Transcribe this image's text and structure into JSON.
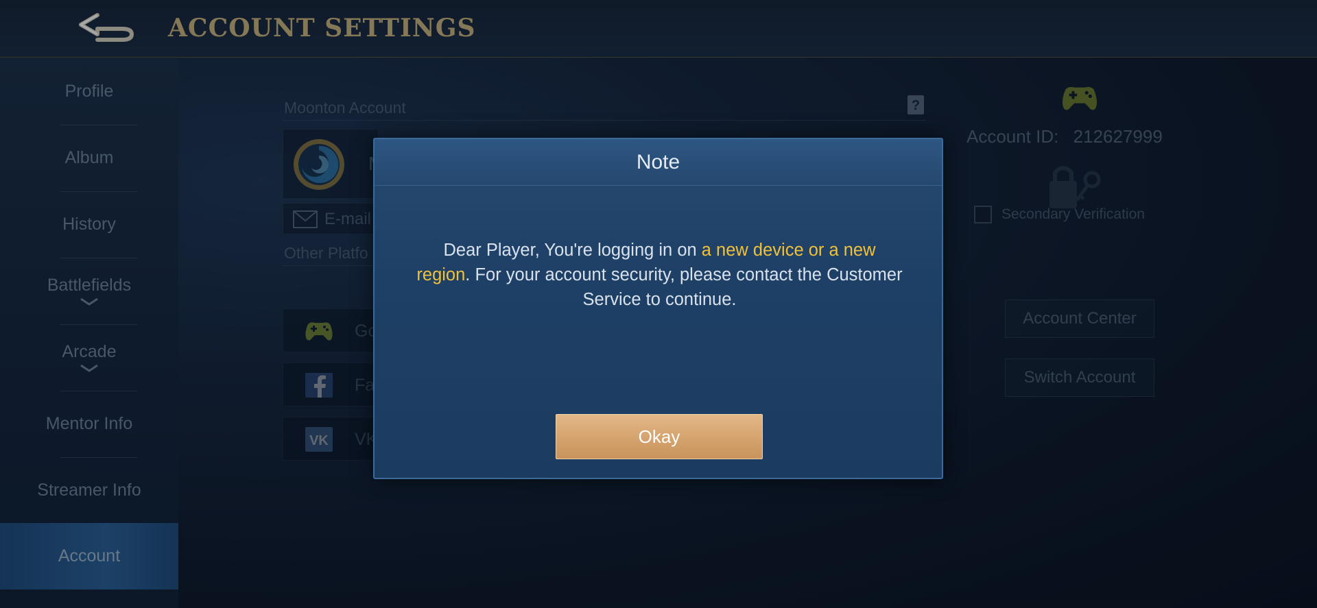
{
  "header": {
    "title": "ACCOUNT SETTINGS"
  },
  "sidebar": {
    "items": [
      {
        "label": "Profile"
      },
      {
        "label": "Album"
      },
      {
        "label": "History"
      },
      {
        "label": "Battlefields",
        "has_chevron": true
      },
      {
        "label": "Arcade",
        "has_chevron": true
      },
      {
        "label": "Mentor Info"
      },
      {
        "label": "Streamer Info"
      },
      {
        "label": "Account",
        "active": true
      }
    ]
  },
  "main": {
    "moonton_label": "Moonton Account",
    "moonton_name_partial": "M",
    "email_partial": "E-mail",
    "other_platforms_partial": "Other Platfo",
    "platforms": [
      {
        "label": "Go",
        "icon": "gamepad-icon"
      },
      {
        "label": "Fa",
        "icon": "facebook-icon"
      },
      {
        "label": "VK",
        "icon": "vk-icon"
      }
    ]
  },
  "right_panel": {
    "account_id_label": "Account ID:",
    "account_id": "212627999",
    "secondary_verification": "Secondary Verification",
    "account_center_label": "Account Center",
    "switch_account_label": "Switch Account"
  },
  "modal": {
    "title": "Note",
    "message_part1": "Dear Player, You're logging in on ",
    "message_highlight": "a new device or a new region",
    "message_part2": ". For your account security, please contact the Customer Service to continue.",
    "ok_label": "Okay"
  },
  "colors": {
    "title_gold": "#cbb47c",
    "highlight_yellow": "#f0c13a",
    "ok_button": "#d6a46f",
    "accent_green": "#b6c72a"
  }
}
